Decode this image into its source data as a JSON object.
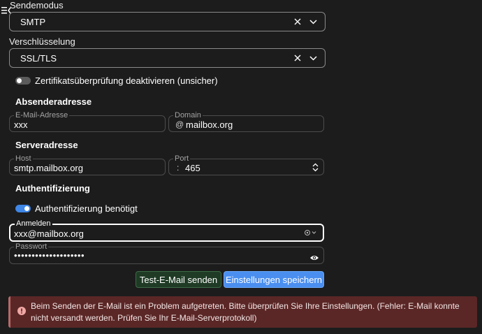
{
  "send_mode": {
    "label": "Sendemodus",
    "value": "SMTP"
  },
  "encryption": {
    "label": "Verschlüsselung",
    "value": "SSL/TLS"
  },
  "cert_check_toggle": {
    "label": "Zertifikatsüberprüfung deaktivieren (unsicher)",
    "state": "off"
  },
  "sender_section": {
    "title": "Absenderadresse",
    "email_label": "E-Mail-Adresse",
    "email_value": "xxx",
    "domain_label": "Domain",
    "domain_prefix": "@",
    "domain_value": "mailbox.org"
  },
  "server_section": {
    "title": "Serveradresse",
    "host_label": "Host",
    "host_value": "smtp.mailbox.org",
    "port_label": "Port",
    "port_prefix": ":",
    "port_value": "465"
  },
  "auth_section": {
    "title": "Authentifizierung",
    "toggle_label": "Authentifizierung benötigt",
    "toggle_state": "on",
    "login_label": "Anmelden",
    "login_value": "xxx@mailbox.org",
    "password_label": "Passwort",
    "password_value": "••••••••••••••••••••"
  },
  "buttons": {
    "test_label": "Test-E-Mail senden",
    "save_label": "Einstellungen speichern"
  },
  "error_alert": {
    "message": "Beim Senden der E-Mail ist ein Problem aufgetreten. Bitte überprüfen Sie Ihre Einstellungen. (Fehler: E-Mail konnte nicht versandt werden. Prüfen Sie Ihr E-Mail-Serverprotokoll)"
  },
  "colors": {
    "background": "#1c1c1c",
    "accent": "#4a8ff0",
    "toggle_on": "#3f86e6",
    "test_button": "#1f3b25",
    "error_background": "#5a2726"
  }
}
